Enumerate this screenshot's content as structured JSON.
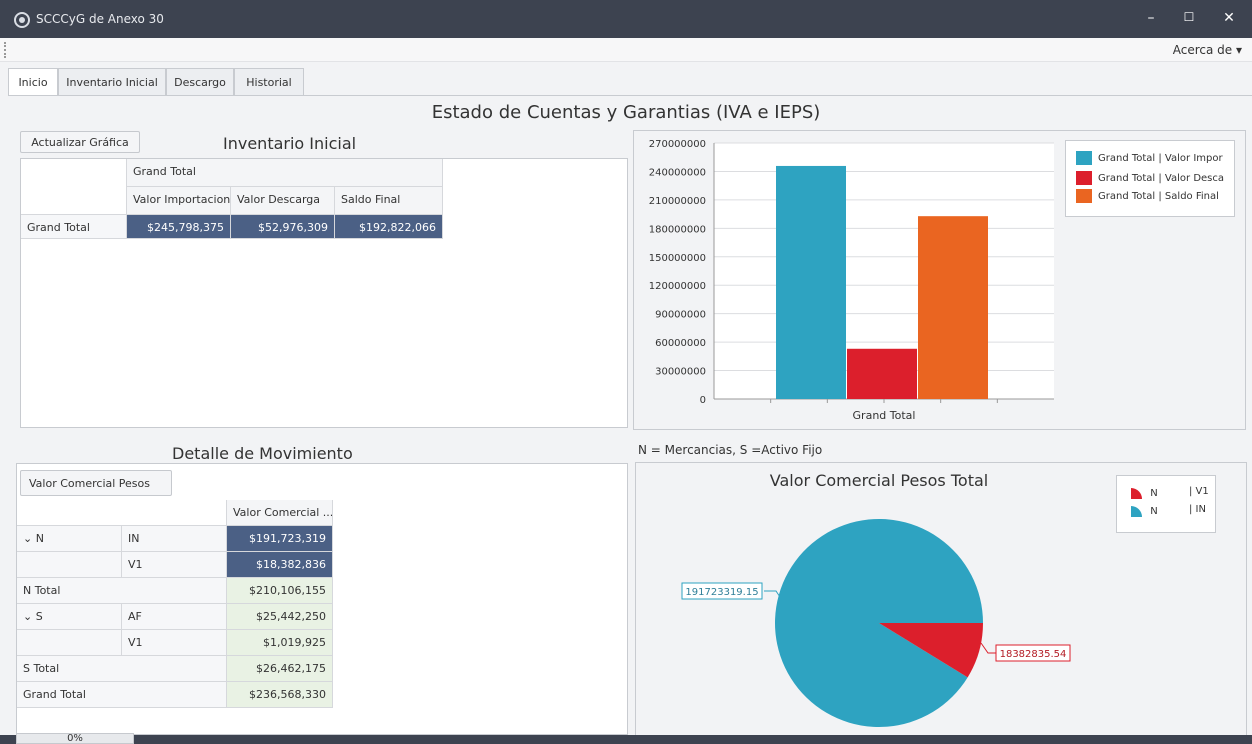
{
  "app": {
    "title": "SCCCyG de Anexo 30"
  },
  "window_controls": {
    "minimize": "–",
    "maximize": "☐",
    "close": "✕"
  },
  "menu": {
    "about": "Acerca de ▾"
  },
  "tabs": [
    {
      "label": "Inicio",
      "active": true
    },
    {
      "label": "Inventario Inicial",
      "active": false
    },
    {
      "label": "Descargo",
      "active": false
    },
    {
      "label": "Historial",
      "active": false
    }
  ],
  "main_title": "Estado de Cuentas y Garantias (IVA e IEPS)",
  "inventario": {
    "refresh_button": "Actualizar Gráfica",
    "title": "Inventario Inicial",
    "header_group": "Grand Total",
    "columns": [
      "Valor Importacion",
      "Valor Descarga",
      "Saldo Final"
    ],
    "row_label": "Grand Total",
    "values": [
      "$245,798,375",
      "$52,976,309",
      "$192,822,066"
    ]
  },
  "bar_chart": {
    "x_label": "Grand Total",
    "y_ticks": [
      "270000000",
      "240000000",
      "210000000",
      "180000000",
      "150000000",
      "120000000",
      "90000000",
      "60000000",
      "30000000",
      "0"
    ],
    "legend": [
      "Grand Total | Valor Impor",
      "Grand Total | Valor Desca",
      "Grand Total | Saldo Final"
    ]
  },
  "chart_data": [
    {
      "type": "bar",
      "categories": [
        "Grand Total"
      ],
      "series": [
        {
          "name": "Grand Total | Valor Importacion",
          "values": [
            245798375
          ],
          "color": "#2ea3c1"
        },
        {
          "name": "Grand Total | Valor Descarga",
          "values": [
            52976309
          ],
          "color": "#dc1f2c"
        },
        {
          "name": "Grand Total | Saldo Final",
          "values": [
            192822066
          ],
          "color": "#ea6521"
        }
      ],
      "ylim": [
        0,
        270000000
      ],
      "grid": true,
      "legend_position": "top-right"
    },
    {
      "type": "pie",
      "title": "Valor Comercial Pesos Total",
      "labels": [
        "N | IN",
        "N | V1"
      ],
      "values": [
        191723319.15,
        18382835.54
      ],
      "colors": [
        "#2ea3c1",
        "#dc1f2c"
      ],
      "legend_position": "top-right"
    }
  ],
  "detalle": {
    "title": "Detalle de Movimiento",
    "field_button": "Valor Comercial Pesos",
    "column_header": "Valor Comercial ...",
    "rows": [
      {
        "g1": "⌄ N",
        "g2": "IN",
        "value": "$191,723,319",
        "kind": "sel"
      },
      {
        "g1": "",
        "g2": "V1",
        "value": "$18,382,836",
        "kind": "sel"
      },
      {
        "g1": "N      Total",
        "g2": "",
        "value": "$210,106,155",
        "kind": "total"
      },
      {
        "g1": "⌄ S",
        "g2": "AF",
        "value": "$25,442,250",
        "kind": "val"
      },
      {
        "g1": "",
        "g2": "V1",
        "value": "$1,019,925",
        "kind": "val"
      },
      {
        "g1": "S      Total",
        "g2": "",
        "value": "$26,462,175",
        "kind": "total"
      },
      {
        "g1": "Grand Total",
        "g2": "",
        "value": "$236,568,330",
        "kind": "total"
      }
    ]
  },
  "pie_panel": {
    "note": "N = Mercancias, S =Activo Fijo",
    "title": "Valor Comercial Pesos Total",
    "legend": [
      {
        "g": "N",
        "s": "| V1"
      },
      {
        "g": "N",
        "s": "| IN"
      }
    ],
    "label_big": "191723319.15",
    "label_small": "18382835.54"
  },
  "status": {
    "progress": "0%"
  }
}
